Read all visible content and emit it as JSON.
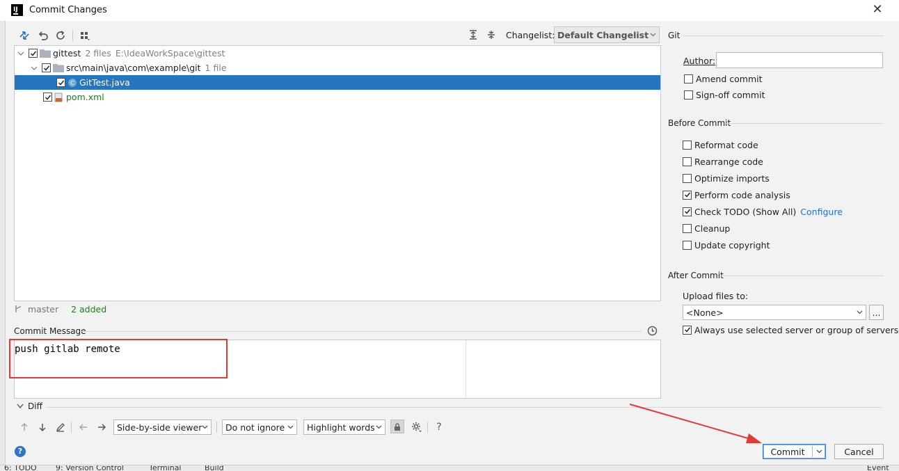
{
  "window": {
    "title": "Commit Changes"
  },
  "toolbar": {
    "changelist_label": "Changelist:",
    "changelist_value": "Default Changelist"
  },
  "tree": {
    "root": {
      "name": "gittest",
      "count": "2 files",
      "path": "E:\\IdeaWorkSpace\\gittest"
    },
    "package": {
      "name": "src\\main\\java\\com\\example\\git",
      "count": "1 file"
    },
    "file1": {
      "name": "GitTest.java"
    },
    "file2": {
      "name": "pom.xml"
    }
  },
  "status": {
    "branch": "master",
    "summary": "2 added"
  },
  "commit_message": {
    "label": "Commit Message",
    "text": "push gitlab remote"
  },
  "diff": {
    "label": "Diff",
    "viewer": "Side-by-side viewer",
    "ignore": "Do not ignore",
    "highlight": "Highlight words",
    "help": "?"
  },
  "git": {
    "section": "Git",
    "author_label": "Author:",
    "author_value": "",
    "amend": "Amend commit",
    "signoff": "Sign-off commit"
  },
  "before_commit": {
    "section": "Before Commit",
    "items": [
      {
        "label": "Reformat code",
        "checked": false
      },
      {
        "label": "Rearrange code",
        "checked": false
      },
      {
        "label": "Optimize imports",
        "checked": false
      },
      {
        "label": "Perform code analysis",
        "checked": true
      },
      {
        "label": "Check TODO (Show All)",
        "checked": true
      },
      {
        "label": "Cleanup",
        "checked": false
      },
      {
        "label": "Update copyright",
        "checked": false
      }
    ],
    "configure_link": "Configure"
  },
  "after_commit": {
    "section": "After Commit",
    "upload_label": "Upload files to:",
    "upload_value": "<None>",
    "browse": "...",
    "always_use": "Always use selected server or group of servers"
  },
  "buttons": {
    "commit": "Commit",
    "cancel": "Cancel"
  },
  "bottom_bar": {
    "todo": "6: TODO",
    "vcs": "9: Version Control",
    "terminal": "Terminal",
    "build": "Build",
    "event_log": "Event Lo"
  },
  "colors": {
    "selection": "#2675bf",
    "added": "#1a7f1a",
    "link": "#2470c2",
    "annotation": "#e53935"
  }
}
